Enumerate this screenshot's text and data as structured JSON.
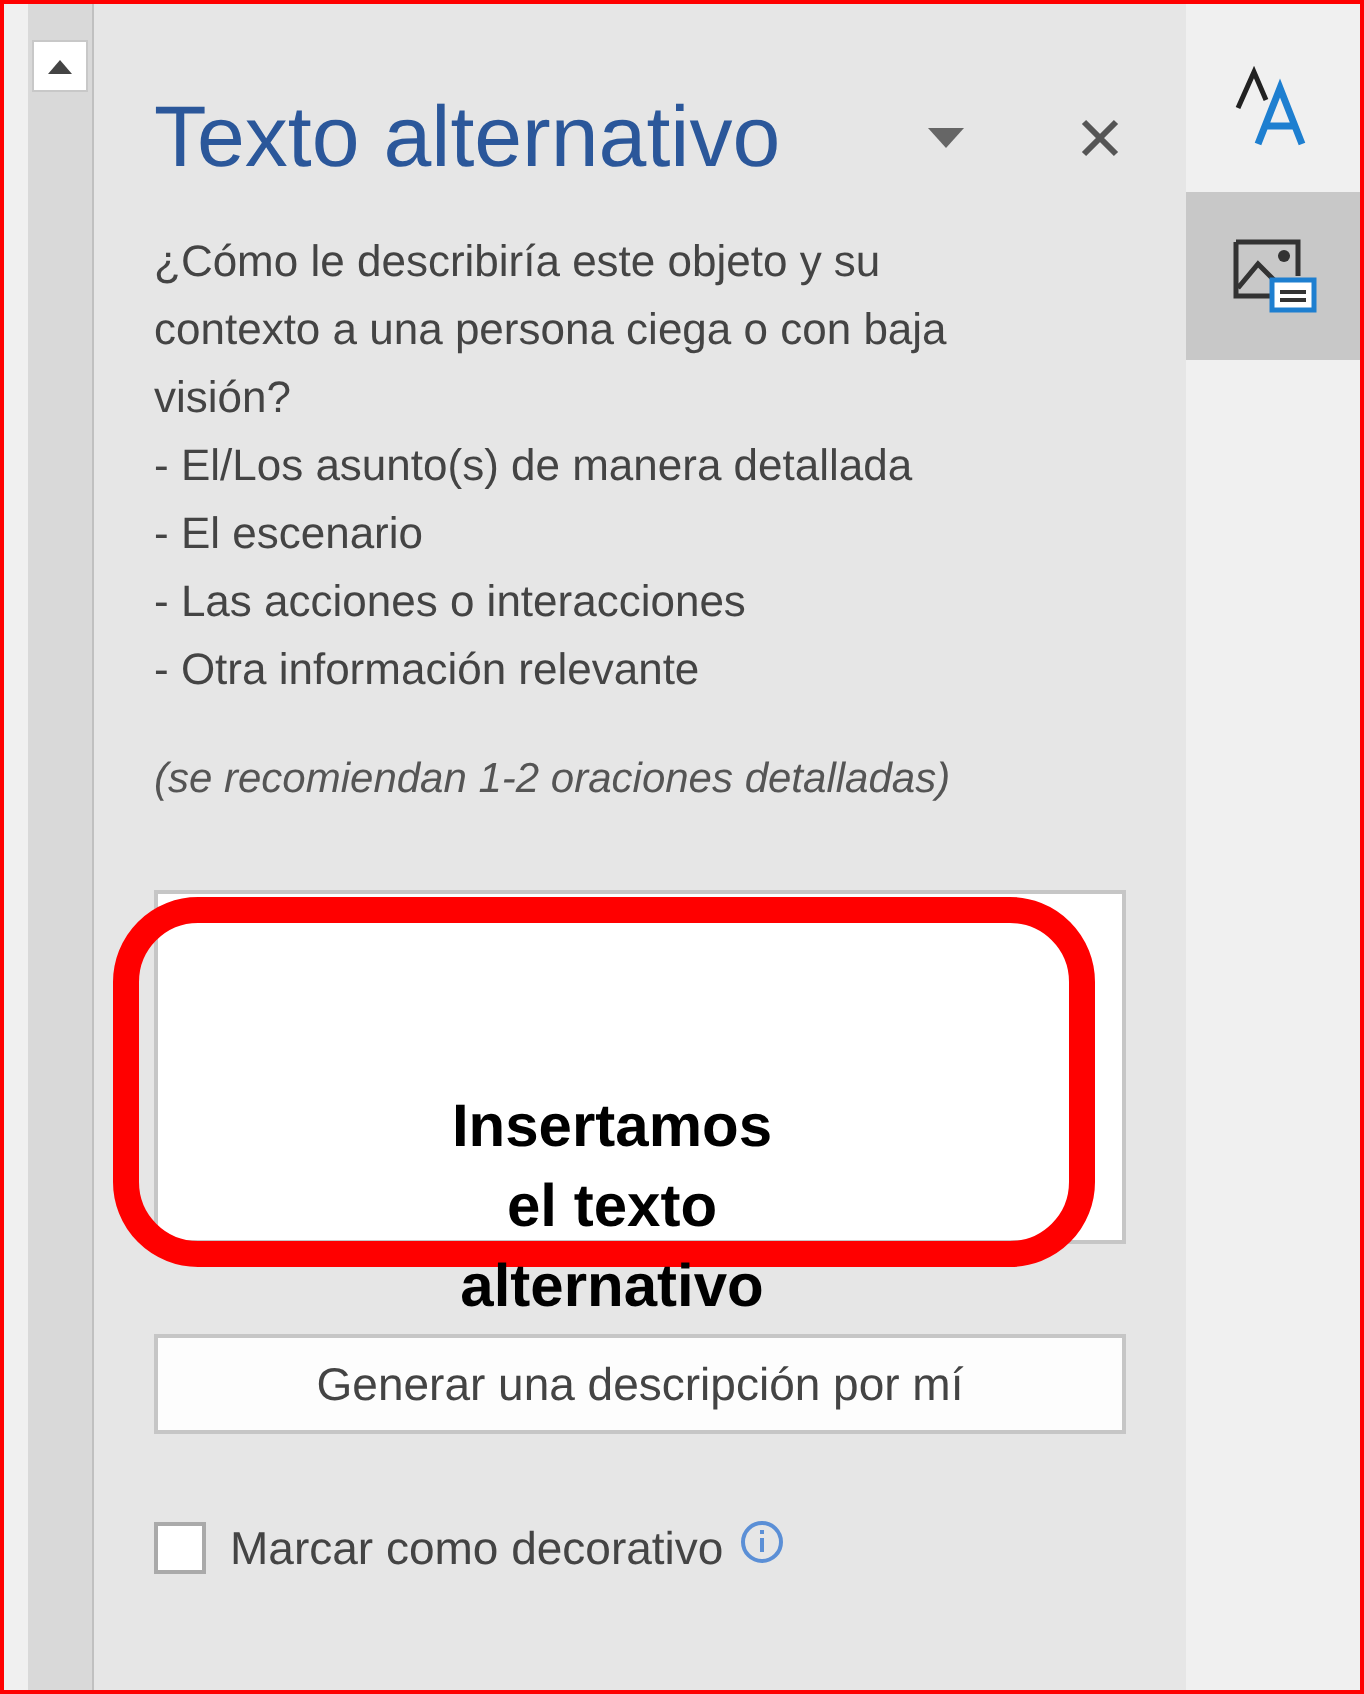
{
  "pane": {
    "title": "Texto alternativo",
    "description": [
      "¿Cómo le describiría este objeto y su contexto a una persona ciega o con baja visión?",
      "- El/Los asunto(s) de manera detallada",
      "- El escenario",
      "- Las acciones o interacciones",
      "- Otra información relevante"
    ],
    "note": "(se recomiendan 1-2 oraciones detalladas)",
    "generate_button": "Generar una descripción por mí",
    "decorative": {
      "label": "Marcar como decorativo",
      "checked": false
    }
  },
  "side_tabs": [
    {
      "kind": "font",
      "selected": false
    },
    {
      "kind": "picture",
      "selected": true
    }
  ],
  "annotation": {
    "lines": [
      "Insertamos",
      "el texto",
      "alternativo"
    ]
  }
}
